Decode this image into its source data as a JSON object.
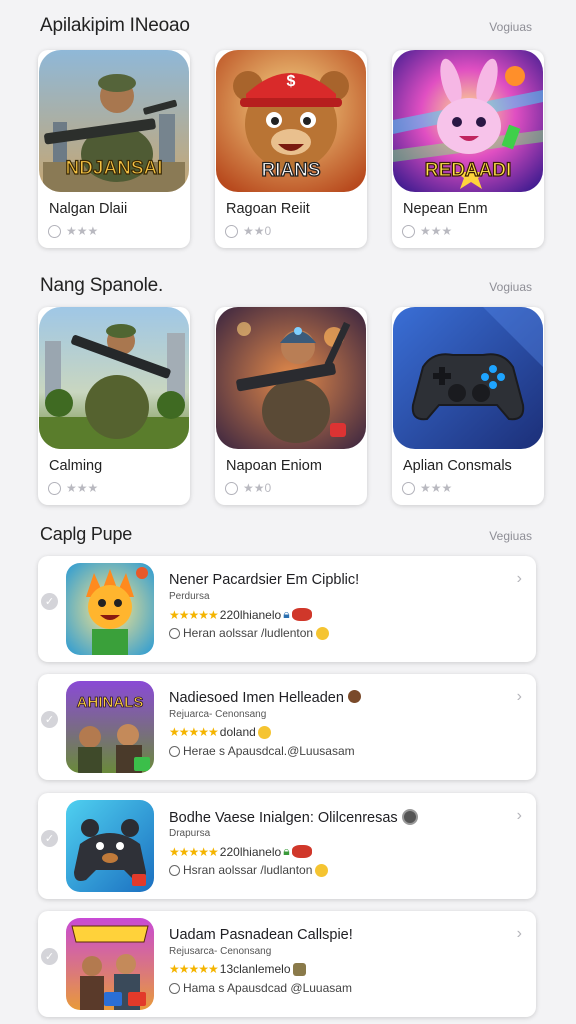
{
  "sections": [
    {
      "title": "Apilakipim INeoao",
      "see_more": "Vogiuas",
      "cards": [
        {
          "title": "Nalgan Dlaii",
          "rating": "★★★",
          "art_label": "NDJANSAI"
        },
        {
          "title": "Ragoan Reiit",
          "rating": "★★0",
          "art_label": "RIANS"
        },
        {
          "title": "Nepean Enm",
          "rating": "★★★",
          "art_label": "REDAADI"
        }
      ]
    },
    {
      "title": "Nang Spanole.",
      "see_more": "Vogiuas",
      "cards": [
        {
          "title": "Calming",
          "rating": "★★★"
        },
        {
          "title": "Napoan Eniom",
          "rating": "★★0"
        },
        {
          "title": "Aplian Consmals",
          "rating": "★★★"
        }
      ]
    }
  ],
  "list_section": {
    "title": "Caplg Pupe",
    "see_more": "Vegiuas",
    "items": [
      {
        "title": "Nener Pacardsier Em Cipblic!",
        "subtitle": "Perdursa",
        "stars": "★★★★★",
        "rating_text": "220lhianelo",
        "meta": "Heran aolssar /ludlenton"
      },
      {
        "title": "Nadiesoed Imen Helleaden",
        "subtitle": "Rejuarca- Cenonsang",
        "stars": "★★★★★",
        "rating_text": "doland",
        "meta": "Herae s Apausdcal.@Luusasam",
        "thumb_label": "AHINALS"
      },
      {
        "title": "Bodhe Vaese Inialgen: Olilcenresas",
        "subtitle": "Drapursa",
        "stars": "★★★★★",
        "rating_text": "220lhianelo",
        "meta": "Hsran aolssar /ludlanton"
      },
      {
        "title": "Uadam Pasnadean Callspie!",
        "subtitle": "Rejusarca- Cenonsang",
        "stars": "★★★★★",
        "rating_text": "13clanlemelo",
        "meta": "Hama s Apausdcad @Luuasam"
      }
    ]
  }
}
